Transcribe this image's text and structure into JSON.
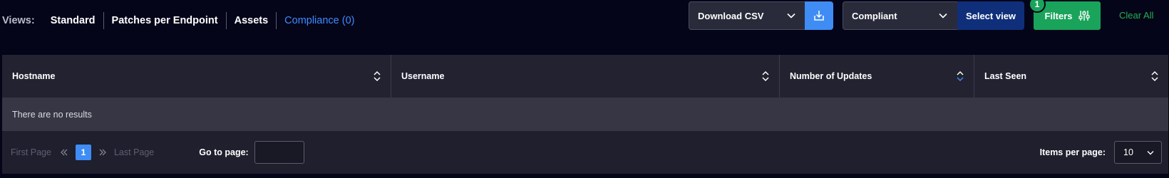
{
  "views": {
    "label": "Views:",
    "items": [
      "Standard",
      "Patches per Endpoint",
      "Assets",
      "Compliance (0)"
    ],
    "active": "Compliance (0)"
  },
  "toolbar": {
    "download_label": "Download CSV",
    "compliance_select": "Compliant",
    "select_view_label": "Select view",
    "filters_label": "Filters",
    "filters_count": "1",
    "clear_all_label": "Clear All"
  },
  "table": {
    "columns": [
      "Hostname",
      "Username",
      "Number of Updates",
      "Last Seen"
    ],
    "empty_message": "There are no results"
  },
  "pagination": {
    "first_page": "First Page",
    "current_page": "1",
    "last_page": "Last Page",
    "goto_label": "Go to page:",
    "goto_value": "",
    "items_per_page_label": "Items per page:",
    "items_per_page_value": "10"
  },
  "colors": {
    "background": "#05051a",
    "accent_blue": "#3f8cf4",
    "filters_green": "#1aa35a",
    "select_view_navy": "#102f7a",
    "clear_all_green": "#23b14d"
  }
}
